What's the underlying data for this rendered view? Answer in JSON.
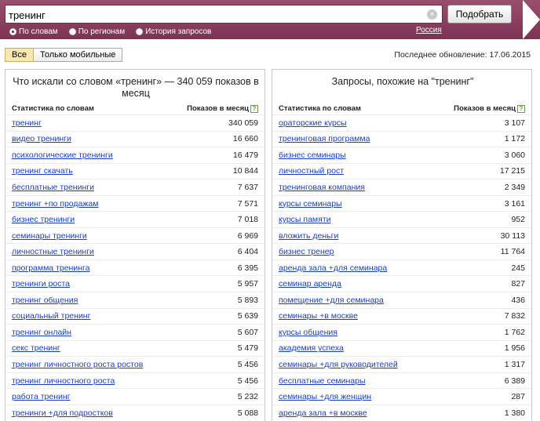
{
  "search": {
    "value": "тренинг",
    "submit_label": "Подобрать",
    "clear_icon": "×"
  },
  "modes": [
    {
      "label": "По словам",
      "checked": true
    },
    {
      "label": "По регионам",
      "checked": false
    },
    {
      "label": "История запросов",
      "checked": false
    }
  ],
  "region": "Россия",
  "filters": {
    "all_label": "Все",
    "mobile_label": "Только мобильные"
  },
  "last_update": "Последнее обновление: 17.06.2015",
  "left_panel": {
    "title": "Что искали со словом «тренинг» — 340 059 показов в месяц",
    "col_keyword": "Статистика по словам",
    "col_count": "Показов в месяц",
    "rows": [
      {
        "keyword": "тренинг",
        "count": "340 059"
      },
      {
        "keyword": "видео тренинги",
        "count": "16 660"
      },
      {
        "keyword": "психологические тренинги",
        "count": "16 479"
      },
      {
        "keyword": "тренинг скачать",
        "count": "10 844"
      },
      {
        "keyword": "бесплатные тренинги",
        "count": "7 637"
      },
      {
        "keyword": "тренинг +по продажам",
        "count": "7 571"
      },
      {
        "keyword": "бизнес тренинги",
        "count": "7 018"
      },
      {
        "keyword": "семинары тренинги",
        "count": "6 969"
      },
      {
        "keyword": "личностные тренинги",
        "count": "6 404"
      },
      {
        "keyword": "программа тренинга",
        "count": "6 395"
      },
      {
        "keyword": "тренинги роста",
        "count": "5 957"
      },
      {
        "keyword": "тренинг общения",
        "count": "5 893"
      },
      {
        "keyword": "социальный тренинг",
        "count": "5 639"
      },
      {
        "keyword": "тренинг онлайн",
        "count": "5 607"
      },
      {
        "keyword": "секс тренинг",
        "count": "5 479"
      },
      {
        "keyword": "тренинг личностного роста ростов",
        "count": "5 456"
      },
      {
        "keyword": "тренинг личностного роста",
        "count": "5 456"
      },
      {
        "keyword": "работа тренинг",
        "count": "5 232"
      },
      {
        "keyword": "тренинги +для подростков",
        "count": "5 088"
      }
    ]
  },
  "right_panel": {
    "title": "Запросы, похожие на \"тренинг\"",
    "col_keyword": "Статистика по словам",
    "col_count": "Показов в месяц",
    "rows": [
      {
        "keyword": "ораторские курсы",
        "count": "3 107"
      },
      {
        "keyword": "тренинговая программа",
        "count": "1 172"
      },
      {
        "keyword": "бизнес семинары",
        "count": "3 060"
      },
      {
        "keyword": "личностный рост",
        "count": "17 215"
      },
      {
        "keyword": "тренинговая компания",
        "count": "2 349"
      },
      {
        "keyword": "курсы семинары",
        "count": "3 161"
      },
      {
        "keyword": "курсы памяти",
        "count": "952"
      },
      {
        "keyword": "вложить деньги",
        "count": "30 113"
      },
      {
        "keyword": "бизнес тренер",
        "count": "11 764"
      },
      {
        "keyword": "аренда зала +для семинара",
        "count": "245"
      },
      {
        "keyword": "семинар аренда",
        "count": "827"
      },
      {
        "keyword": "помещение +для семинара",
        "count": "436"
      },
      {
        "keyword": "семинары +в москве",
        "count": "7 832"
      },
      {
        "keyword": "курсы общения",
        "count": "1 762"
      },
      {
        "keyword": "академия успеха",
        "count": "1 956"
      },
      {
        "keyword": "семинары +для руководителей",
        "count": "1 317"
      },
      {
        "keyword": "бесплатные семинары",
        "count": "6 389"
      },
      {
        "keyword": "семинары +для женщин",
        "count": "287"
      },
      {
        "keyword": "аренда зала +в москве",
        "count": "1 380"
      }
    ]
  }
}
